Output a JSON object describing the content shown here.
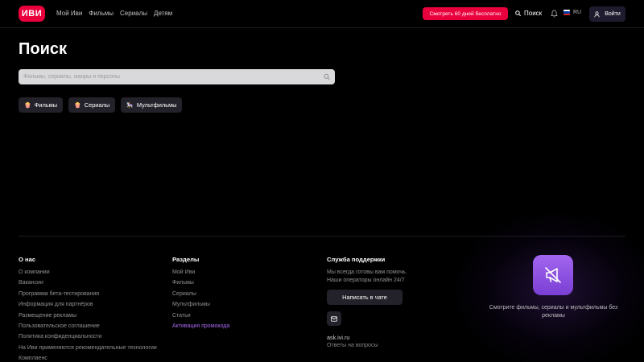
{
  "header": {
    "logo_text": "ИВИ",
    "nav": [
      "Мой Иви",
      "Фильмы",
      "Сериалы",
      "Детям"
    ],
    "cta_label": "Смотреть 60 дней бесплатно",
    "search_label": "Поиск",
    "lang_label": "RU",
    "login_label": "Войти"
  },
  "main": {
    "title": "Поиск",
    "search_placeholder": "Фильмы, сериалы, жанры и персоны",
    "chips": [
      {
        "emoji": "🍿",
        "label": "Фильмы"
      },
      {
        "emoji": "🍿",
        "label": "Сериалы"
      },
      {
        "emoji": "🎠",
        "label": "Мультфильмы"
      }
    ]
  },
  "footer": {
    "about": {
      "heading": "О нас",
      "links": [
        "О компании",
        "Вакансии",
        "Программа бета-тестирования",
        "Информация для партнёров",
        "Размещение рекламы",
        "Пользовательское соглашение",
        "Политика конфиденциальности",
        "На Иви применяются рекомендательные технологии",
        "Комплаенс"
      ]
    },
    "sections": {
      "heading": "Разделы",
      "links": [
        "Мой Иви",
        "Фильмы",
        "Сериалы",
        "Мультфильмы",
        "Статьи"
      ],
      "accent_link": "Активация промокода"
    },
    "support": {
      "heading": "Служба поддержки",
      "line1": "Мы всегда готовы вам помочь.",
      "line2": "Наши операторы онлайн 24/7",
      "chat_label": "Написать в чате",
      "site": "ask.ivi.ru",
      "site_sub": "Ответы на вопросы"
    },
    "promo": {
      "text": "Смотрите фильмы, сериалы и мультфильмы без рекламы"
    }
  },
  "colors": {
    "accent_red": "#ea003d",
    "accent_purple": "#a869f0",
    "background": "#000000"
  }
}
